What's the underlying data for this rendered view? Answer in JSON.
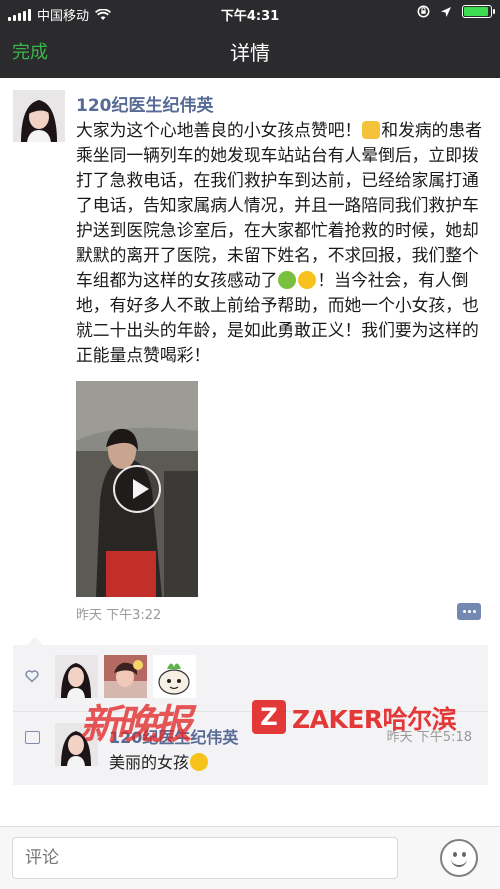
{
  "status_bar": {
    "carrier": "中国移动",
    "time": "下午4:31"
  },
  "nav": {
    "back_label": "完成",
    "title": "详情"
  },
  "post": {
    "author": "120纪医生纪伟英",
    "text_parts": [
      "大家为这个心地善良的小女孩点赞吧！",
      "和发病的患者乘坐同一辆列车的她发现车站站台有人晕倒后，立即拨打了急救电话，在我们救护车到达前，已经给家属打通了电话，告知家属病人情况，并且一路陪同我们救护车护送到医院急诊室后，在大家都忙着抢救的时候，她却默默的离开了医院，未留下姓名，不求回报，我们整个车组都为这样的女孩感动了",
      "！当今社会，有人倒地，有好多人不敢上前给予帮助，而她一个小女孩，也就二十出头的年龄，是如此勇敢正义！我们要为这样的正能量点赞喝彩！"
    ],
    "time": "昨天 下午3:22"
  },
  "comments": [
    {
      "name": "120纪医生纪伟英",
      "time": "昨天 下午5:18",
      "text": "美丽的女孩"
    }
  ],
  "watermark": {
    "logo_text": "新晚报",
    "brand": "ZAKER哈尔滨"
  },
  "input": {
    "placeholder": "评论"
  },
  "colors": {
    "bar_bg": "#2b2b2e",
    "accent_green": "#3ab54a",
    "name_blue": "#576b95"
  }
}
